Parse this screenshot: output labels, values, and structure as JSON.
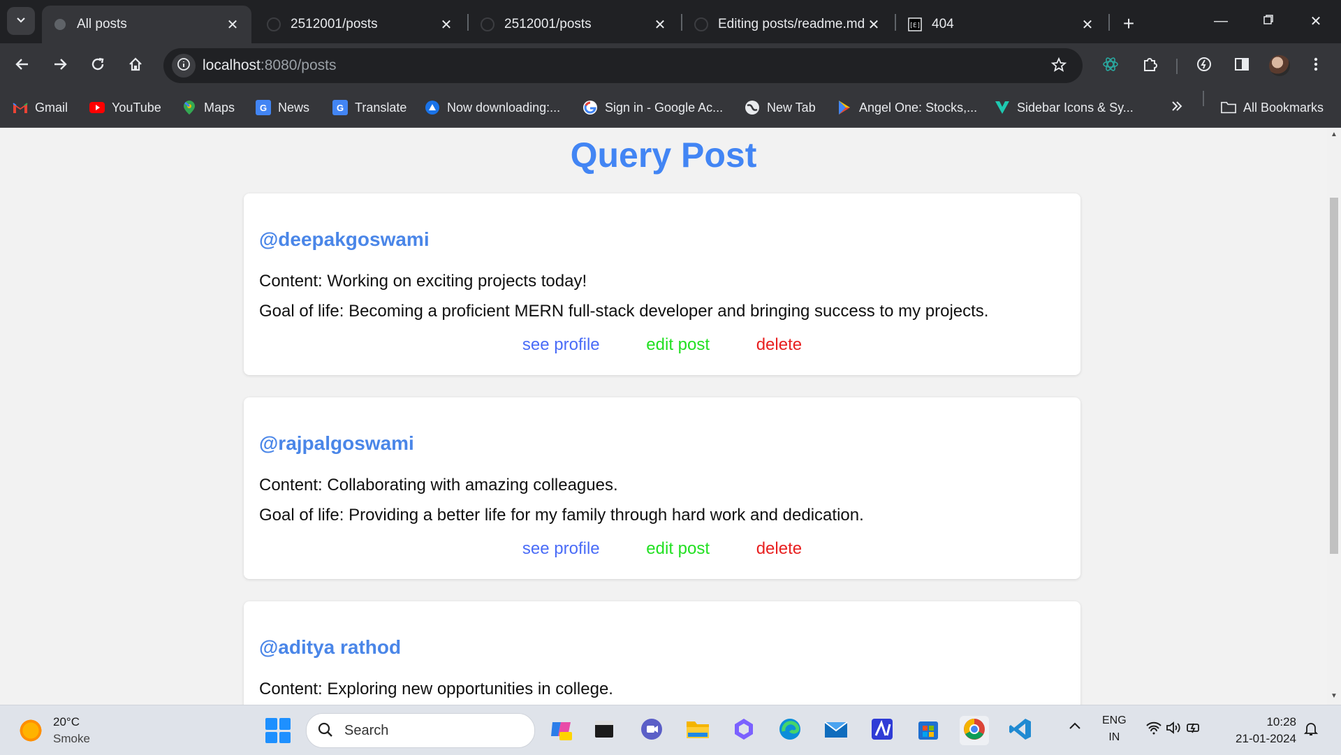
{
  "tabs": [
    {
      "title": "All posts",
      "active": true,
      "icon": "globe-icon"
    },
    {
      "title": "2512001/posts",
      "active": false,
      "icon": "github-icon"
    },
    {
      "title": "2512001/posts",
      "active": false,
      "icon": "github-icon"
    },
    {
      "title": "Editing posts/readme.md",
      "active": false,
      "icon": "github-icon"
    },
    {
      "title": "404",
      "active": false,
      "icon": "express-icon"
    }
  ],
  "address_bar": {
    "host": "localhost",
    "path": ":8080/posts"
  },
  "bookmarks": [
    {
      "label": "Gmail",
      "icon": "gmail-icon"
    },
    {
      "label": "YouTube",
      "icon": "youtube-icon"
    },
    {
      "label": "Maps",
      "icon": "maps-icon"
    },
    {
      "label": "News",
      "icon": "news-icon"
    },
    {
      "label": "Translate",
      "icon": "translate-icon"
    },
    {
      "label": "Now downloading:...",
      "icon": "download-icon"
    },
    {
      "label": "Sign in - Google Ac...",
      "icon": "google-icon"
    },
    {
      "label": "New Tab",
      "icon": "globe-icon"
    },
    {
      "label": "Angel One: Stocks,...",
      "icon": "play-store-icon"
    },
    {
      "label": "Sidebar Icons & Sy...",
      "icon": "vuetify-icon"
    }
  ],
  "all_bookmarks_label": "All Bookmarks",
  "page": {
    "title": "Query Post",
    "posts": [
      {
        "username": "@deepakgoswami",
        "content": "Content: Working on exciting projects today!",
        "goal": "Goal of life: Becoming a proficient MERN full-stack developer and bringing success to my projects."
      },
      {
        "username": "@rajpalgoswami",
        "content": "Content: Collaborating with amazing colleagues.",
        "goal": "Goal of life: Providing a better life for my family through hard work and dedication."
      },
      {
        "username": "@aditya rathod",
        "content": "Content: Exploring new opportunities in college.",
        "goal": ""
      }
    ],
    "actions": {
      "see_profile": "see profile",
      "edit_post": "edit post",
      "delete": "delete"
    },
    "colors": {
      "title": "#4285f4",
      "see_profile": "#4a6cf7",
      "edit_post": "#22e022",
      "delete": "#e82020"
    }
  },
  "taskbar": {
    "weather": {
      "temp": "20°C",
      "condition": "Smoke"
    },
    "search_label": "Search",
    "language": {
      "line1": "ENG",
      "line2": "IN"
    },
    "clock": {
      "time": "10:28",
      "date": "21-01-2024"
    }
  }
}
